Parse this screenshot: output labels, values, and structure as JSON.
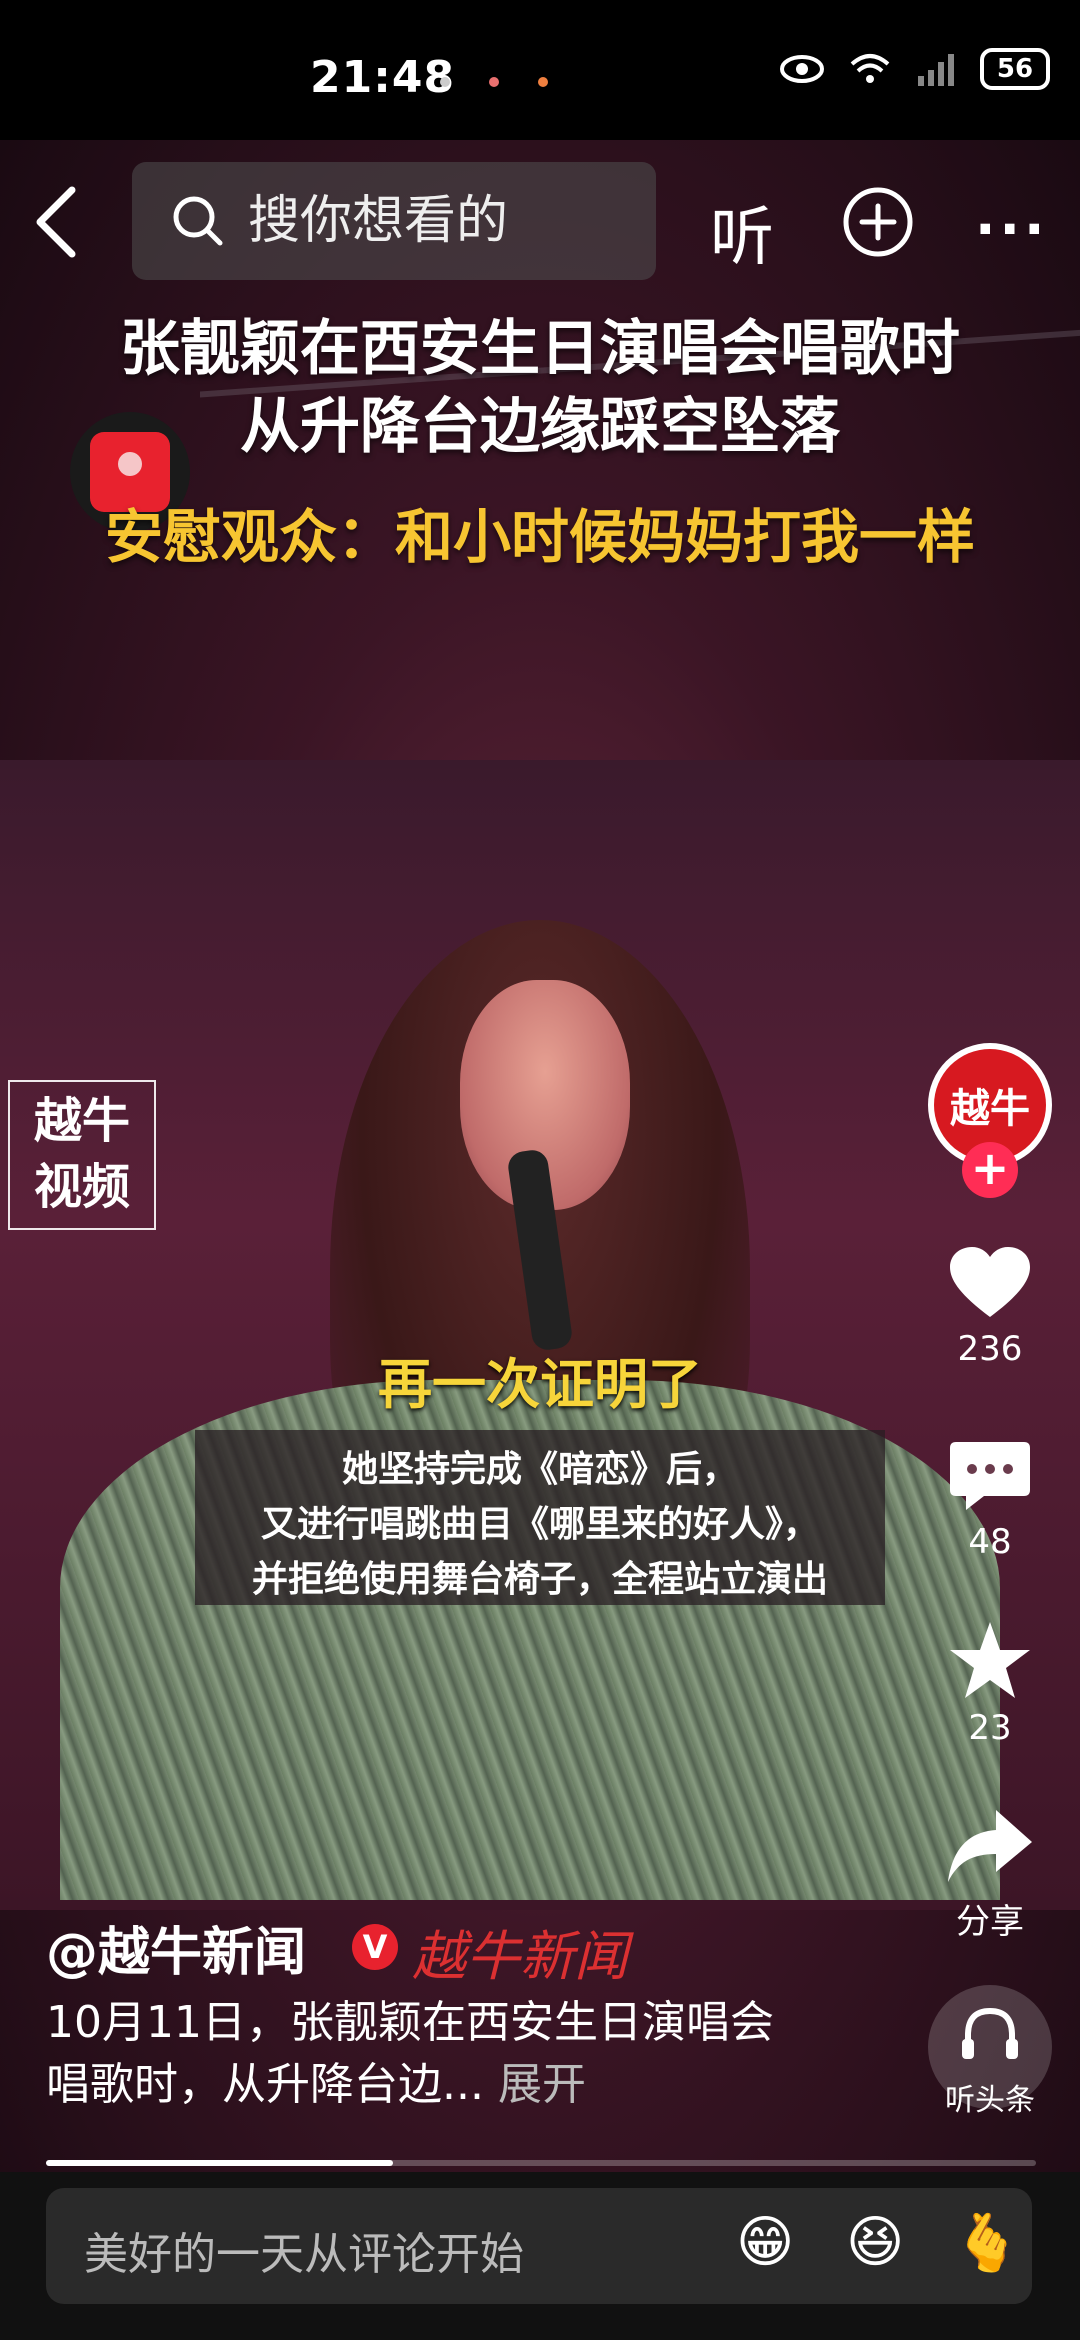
{
  "status_bar": {
    "time": "21:48",
    "battery": "56"
  },
  "nav": {
    "search_placeholder": "搜你想看的",
    "listen_label": "听",
    "more_label": "···"
  },
  "video": {
    "title_line1": "张靓颖在西安生日演唱会唱歌时",
    "title_line2": "从升降台边缘踩空坠落",
    "title_line3": "安慰观众：和小时候妈妈打我一样",
    "watermark": "越牛\n视频",
    "subtitle_highlight": "再一次证明了",
    "subtitle_1": "她坚持完成《暗恋》后，",
    "subtitle_2": "又进行唱跳曲目《哪里来的好人》，",
    "subtitle_3": "并拒绝使用舞台椅子，全程站立演出"
  },
  "rail": {
    "avatar_text": "越牛",
    "likes": "236",
    "comments": "48",
    "favorites": "23",
    "share_label": "分享",
    "listen_label": "听头条"
  },
  "info": {
    "author": "@越牛新闻",
    "verified_mark": "V",
    "brand_mark": "越牛新闻",
    "description": "10月11日，张靓颖在西安生日演唱会唱歌时，从升降台边...",
    "expand_label": "展开"
  },
  "progress": {
    "fraction": 0.35
  },
  "comment": {
    "placeholder": "美好的一天从评论开始",
    "emojis": [
      "😁",
      "😆",
      "🫰"
    ]
  },
  "colors": {
    "accent_red": "#e8222e",
    "subtitle_yellow": "#f7c531"
  },
  "icons": {
    "back": "back-arrow-icon",
    "search": "search-icon",
    "add": "plus-circle-icon",
    "like": "heart-icon",
    "comment": "comment-bubble-icon",
    "favorite": "star-icon",
    "share": "share-arrow-icon",
    "listen": "headphones-icon"
  }
}
